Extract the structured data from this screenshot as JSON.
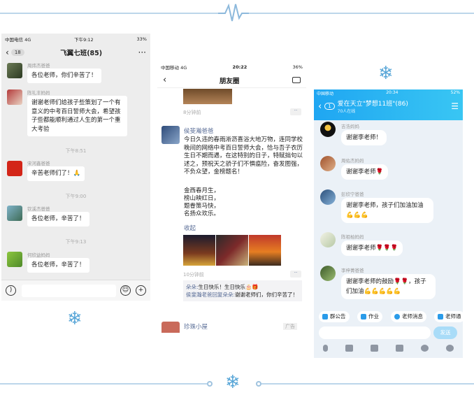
{
  "colors": {
    "line": "#bcd6ea",
    "flake": "#5aa7d8",
    "qq_blue": "#1fa6f2",
    "wechat_link": "#576b95"
  },
  "phone1": {
    "status": {
      "carrier": "中国电信",
      "network": "4G",
      "time": "下午9:12",
      "battery": "33%"
    },
    "nav": {
      "unread": "18",
      "title": "飞翼七班(85)",
      "more": "···"
    },
    "messages": [
      {
        "name": "周炜杰爸爸",
        "text": "各位老师，你们辛苦了！"
      },
      {
        "name": "陈礼丰妈妈",
        "text": "谢谢老师们给孩子些策划了一个有意义的中考百日誓师大会，希望孩子些都能顺利通过人生的第一个重大考验"
      },
      {
        "name": "宋河鑫爸爸",
        "text": "辛苦老师们了！🙏"
      },
      {
        "name": "钦溪杰爸爸",
        "text": "各位老师，辛苦了！"
      },
      {
        "name": "何欣益妈妈",
        "text": "各位老师，辛苦了！"
      }
    ],
    "times": [
      "下午8:51",
      "下午9:00",
      "下午9:13"
    ]
  },
  "phone2": {
    "status": {
      "carrier": "中国移动",
      "network": "4G",
      "time": "20:22",
      "battery": "36%"
    },
    "nav": {
      "title": "朋友圈"
    },
    "prev_time": "8分钟前",
    "post": {
      "author": "侯斐瀚爸爸",
      "text": "今日久违的春雨淅沥喜浴大地万物，连同学校晚间的网络中考百日誓师大会，恰与吾子衣历生日不期而遇，在这特别的日子，特赋拙句以述之，预祝天之骄子们不惧瘟险，奋发图强，不负众望，金榜题名！",
      "poem": [
        "金西春月生，",
        "榜山映红日，",
        "题眷策马快，",
        "名扬众欢乐。"
      ],
      "collapse": "收起",
      "time": "10分钟前"
    },
    "comments": [
      {
        "who": "朵朵:",
        "text": "生日快乐！生日快乐🎂🎁"
      },
      {
        "who": "侯斐瀚老爸回复朵朵:",
        "text": "谢谢老师们，你们辛苦了！"
      }
    ],
    "next": {
      "author": "珍珠小屋",
      "tag": "广告"
    }
  },
  "phone3": {
    "status": {
      "carrier": "中国移动",
      "time": "20:34",
      "battery": "52%"
    },
    "nav": {
      "unread": "1",
      "title": "爱在天立\"梦想11班\"(86)",
      "sub": "70人在线"
    },
    "messages": [
      {
        "name": "吉浩妈妈",
        "text": "谢谢李老师！"
      },
      {
        "name": "周佑杰妈妈",
        "text": "谢谢李老师🌹"
      },
      {
        "name": "彭欣宁爸爸",
        "text": "谢谢李老师，孩子们加油加油💪💪💪"
      },
      {
        "name": "陈祖柏妈妈",
        "text": "谢谢李老师🌹🌹🌹"
      },
      {
        "name": "李梓菁爸爸",
        "text": "谢谢李老师的鼓励🌹🌹，孩子们加油💪💪💪💪💪"
      }
    ],
    "tools": [
      "群公告",
      "作业",
      "老师消息",
      "老师通"
    ],
    "send": "发送"
  }
}
